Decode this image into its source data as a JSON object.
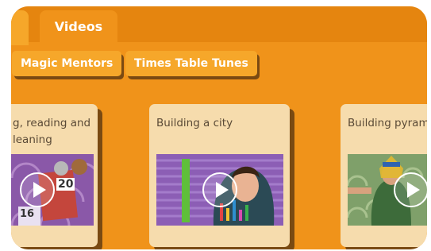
{
  "tabs": {
    "active_label": "Videos"
  },
  "filters": [
    {
      "label": "Magic Mentors"
    },
    {
      "label": "Times Table Tunes"
    }
  ],
  "cards": [
    {
      "title": "g, reading and\nleaning",
      "thumb_text": [
        "20",
        "16"
      ]
    },
    {
      "title": "Building a city"
    },
    {
      "title": "Building pyramids"
    }
  ],
  "colors": {
    "background": "#f0931a",
    "tab_bar": "#e5850f",
    "pill": "#f6a72a",
    "card": "#f6dcad",
    "shadow": "#7a4a12"
  },
  "icons": {
    "play": "play-circle-icon"
  }
}
